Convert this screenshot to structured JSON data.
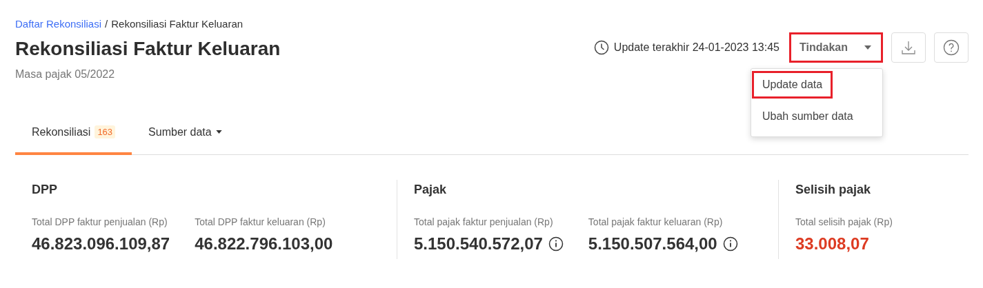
{
  "breadcrumb": [
    {
      "label": "Daftar Rekonsiliasi",
      "kind": "link"
    },
    {
      "label": "/",
      "kind": "separator"
    },
    {
      "label": "Rekonsiliasi Faktur Keluaran",
      "kind": "current"
    }
  ],
  "title": "Rekonsiliasi Faktur Keluaran",
  "subtitle": "Masa pajak 05/2022",
  "last_update": "Update terakhir 24-01-2023 13:45",
  "actions": {
    "label": "Tindakan",
    "highlighted": true,
    "menu": [
      {
        "label": "Update data",
        "highlighted": true
      },
      {
        "label": "Ubah sumber data",
        "highlighted": false
      }
    ]
  },
  "tabs": [
    {
      "label": "Rekonsiliasi",
      "badge": "163",
      "selected": true,
      "dropdown": false
    },
    {
      "label": "Sumber data",
      "selected": false,
      "dropdown": true
    }
  ],
  "sections": [
    {
      "title": "DPP",
      "stats": [
        {
          "label": "Total DPP faktur penjualan (Rp)",
          "value": "46.823.096.109,87",
          "info": false,
          "color": "#333333"
        },
        {
          "label": "Total DPP faktur keluaran (Rp)",
          "value": "46.822.796.103,00",
          "info": false,
          "color": "#333333"
        }
      ]
    },
    {
      "title": "Pajak",
      "stats": [
        {
          "label": "Total pajak faktur penjualan (Rp)",
          "value": "5.150.540.572,07",
          "info": true,
          "color": "#333333"
        },
        {
          "label": "Total pajak faktur keluaran (Rp)",
          "value": "5.150.507.564,00",
          "info": true,
          "color": "#333333"
        }
      ]
    },
    {
      "title": "Selisih pajak",
      "stats": [
        {
          "label": "Total selisih pajak (Rp)",
          "value": "33.008,07",
          "info": false,
          "color": "#dd3b22"
        }
      ]
    }
  ]
}
